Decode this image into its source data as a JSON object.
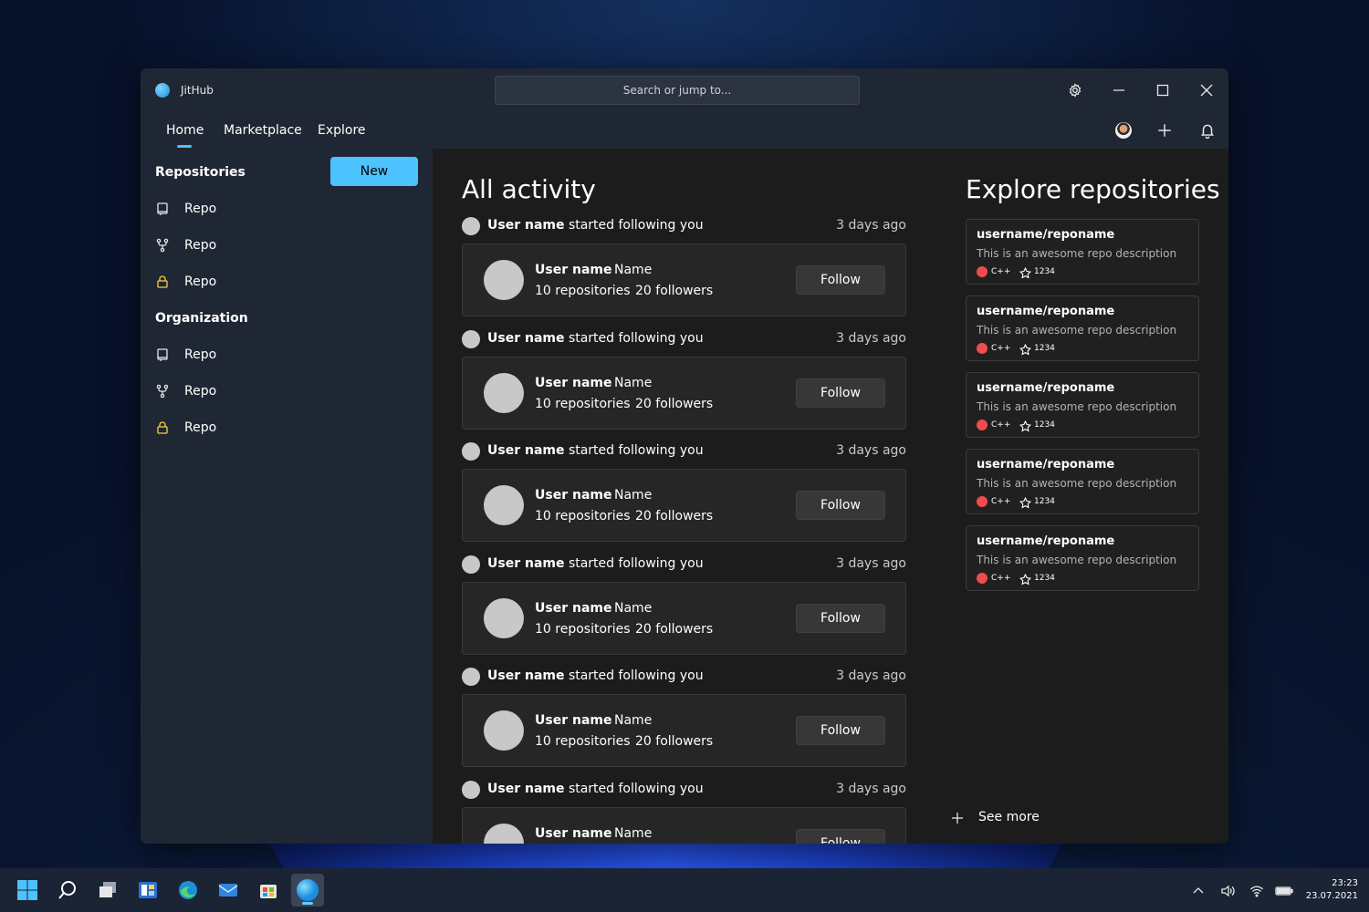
{
  "window": {
    "app_title": "JitHub",
    "search_placeholder": "Search or jump to..."
  },
  "nav": {
    "tabs": [
      "Home",
      "Marketplace",
      "Explore"
    ],
    "active_tab": "Home"
  },
  "sidebar": {
    "repositories_heading": "Repositories",
    "new_button": "New",
    "repositories": [
      {
        "icon": "repo-book-icon",
        "label": "Repo"
      },
      {
        "icon": "fork-icon",
        "label": "Repo"
      },
      {
        "icon": "lock-icon",
        "label": "Repo"
      }
    ],
    "organization_heading": "Organization",
    "organization": [
      {
        "icon": "repo-book-icon",
        "label": "Repo"
      },
      {
        "icon": "fork-icon",
        "label": "Repo"
      },
      {
        "icon": "lock-icon",
        "label": "Repo"
      }
    ]
  },
  "activity": {
    "title": "All activity",
    "events": [
      {
        "user": "User name",
        "action": "started following you",
        "time": "3 days ago",
        "card": {
          "username": "User name",
          "name": "Name",
          "repositories": "10 repositories",
          "followers": "20 followers",
          "button": "Follow"
        }
      },
      {
        "user": "User name",
        "action": "started following you",
        "time": "3 days ago",
        "card": {
          "username": "User name",
          "name": "Name",
          "repositories": "10 repositories",
          "followers": "20 followers",
          "button": "Follow"
        }
      },
      {
        "user": "User name",
        "action": "started following you",
        "time": "3 days ago",
        "card": {
          "username": "User name",
          "name": "Name",
          "repositories": "10 repositories",
          "followers": "20 followers",
          "button": "Follow"
        }
      },
      {
        "user": "User name",
        "action": "started following you",
        "time": "3 days ago",
        "card": {
          "username": "User name",
          "name": "Name",
          "repositories": "10 repositories",
          "followers": "20 followers",
          "button": "Follow"
        }
      },
      {
        "user": "User name",
        "action": "started following you",
        "time": "3 days ago",
        "card": {
          "username": "User name",
          "name": "Name",
          "repositories": "10 repositories",
          "followers": "20 followers",
          "button": "Follow"
        }
      },
      {
        "user": "User name",
        "action": "started following you",
        "time": "3 days ago",
        "card": {
          "username": "User name",
          "name": "Name",
          "repositories": "",
          "followers": "",
          "button": "Follow"
        }
      }
    ]
  },
  "explore": {
    "title": "Explore repositories",
    "repos": [
      {
        "name": "username/reponame",
        "description": "This is an awesome repo description",
        "language": "C++",
        "stars": "1234"
      },
      {
        "name": "username/reponame",
        "description": "This is an awesome repo description",
        "language": "C++",
        "stars": "1234"
      },
      {
        "name": "username/reponame",
        "description": "This is an awesome repo description",
        "language": "C++",
        "stars": "1234"
      },
      {
        "name": "username/reponame",
        "description": "This is an awesome repo description",
        "language": "C++",
        "stars": "1234"
      },
      {
        "name": "username/reponame",
        "description": "This is an awesome repo description",
        "language": "C++",
        "stars": "1234"
      }
    ],
    "see_more": "See more"
  },
  "taskbar": {
    "time": "23:23",
    "date": "23.07.2021"
  },
  "colors": {
    "accent": "#4cc2ff",
    "language_cpp": "#f34b4b"
  }
}
